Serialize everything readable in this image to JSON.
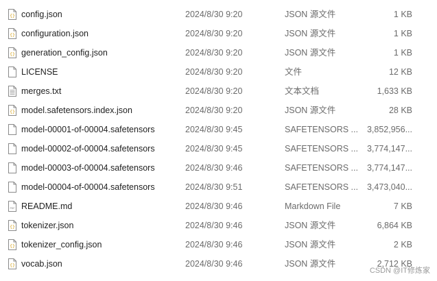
{
  "files": [
    {
      "name": "config.json",
      "date": "2024/8/30 9:20",
      "type": "JSON 源文件",
      "size": "1 KB",
      "icon": "json-file-icon"
    },
    {
      "name": "configuration.json",
      "date": "2024/8/30 9:20",
      "type": "JSON 源文件",
      "size": "1 KB",
      "icon": "json-file-icon"
    },
    {
      "name": "generation_config.json",
      "date": "2024/8/30 9:20",
      "type": "JSON 源文件",
      "size": "1 KB",
      "icon": "json-file-icon"
    },
    {
      "name": "LICENSE",
      "date": "2024/8/30 9:20",
      "type": "文件",
      "size": "12 KB",
      "icon": "blank-file-icon"
    },
    {
      "name": "merges.txt",
      "date": "2024/8/30 9:20",
      "type": "文本文档",
      "size": "1,633 KB",
      "icon": "text-file-icon"
    },
    {
      "name": "model.safetensors.index.json",
      "date": "2024/8/30 9:20",
      "type": "JSON 源文件",
      "size": "28 KB",
      "icon": "json-file-icon"
    },
    {
      "name": "model-00001-of-00004.safetensors",
      "date": "2024/8/30 9:45",
      "type": "SAFETENSORS ...",
      "size": "3,852,956...",
      "icon": "blank-file-icon"
    },
    {
      "name": "model-00002-of-00004.safetensors",
      "date": "2024/8/30 9:45",
      "type": "SAFETENSORS ...",
      "size": "3,774,147...",
      "icon": "blank-file-icon"
    },
    {
      "name": "model-00003-of-00004.safetensors",
      "date": "2024/8/30 9:46",
      "type": "SAFETENSORS ...",
      "size": "3,774,147...",
      "icon": "blank-file-icon"
    },
    {
      "name": "model-00004-of-00004.safetensors",
      "date": "2024/8/30 9:51",
      "type": "SAFETENSORS ...",
      "size": "3,473,040...",
      "icon": "blank-file-icon"
    },
    {
      "name": "README.md",
      "date": "2024/8/30 9:46",
      "type": "Markdown File",
      "size": "7 KB",
      "icon": "markdown-file-icon"
    },
    {
      "name": "tokenizer.json",
      "date": "2024/8/30 9:46",
      "type": "JSON 源文件",
      "size": "6,864 KB",
      "icon": "json-file-icon"
    },
    {
      "name": "tokenizer_config.json",
      "date": "2024/8/30 9:46",
      "type": "JSON 源文件",
      "size": "2 KB",
      "icon": "json-file-icon"
    },
    {
      "name": "vocab.json",
      "date": "2024/8/30 9:46",
      "type": "JSON 源文件",
      "size": "2,712 KB",
      "icon": "json-file-icon"
    }
  ],
  "watermark": "CSDN @IT修炼家",
  "colors": {
    "json_icon_accent": "#d4a017",
    "file_icon_border": "#8a8a8a",
    "secondary_text": "#6b6b6b"
  }
}
